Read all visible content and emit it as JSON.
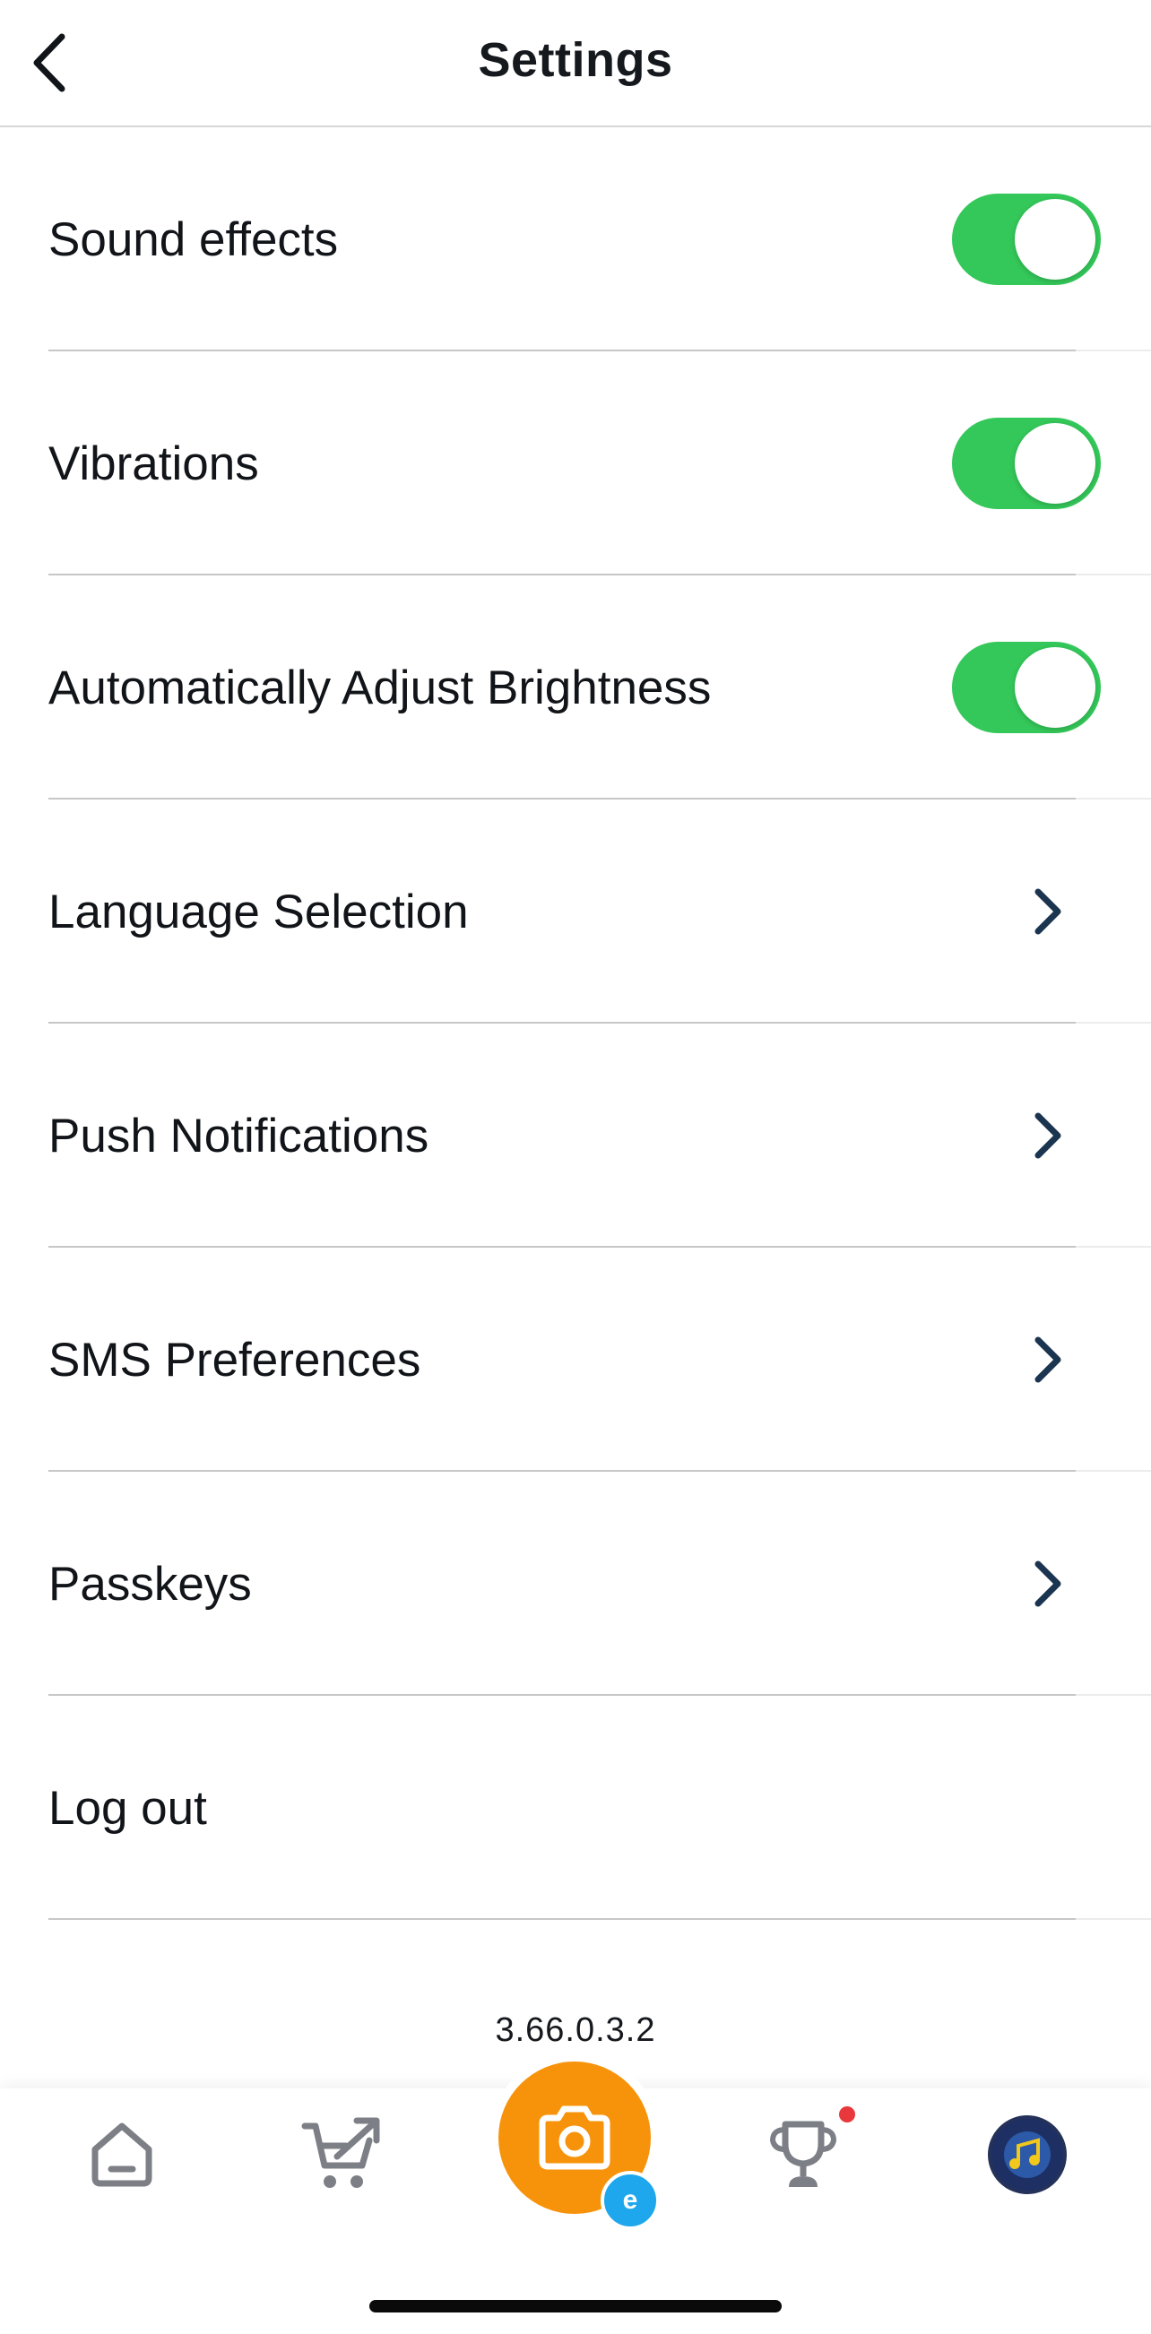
{
  "header": {
    "title": "Settings",
    "back_icon": "chevron-left-icon"
  },
  "settings": {
    "items": [
      {
        "label": "Sound effects",
        "control": "toggle",
        "on": true
      },
      {
        "label": "Vibrations",
        "control": "toggle",
        "on": true
      },
      {
        "label": "Automatically Adjust Brightness",
        "control": "toggle",
        "on": true
      },
      {
        "label": "Language Selection",
        "control": "chevron"
      },
      {
        "label": "Push Notifications",
        "control": "chevron"
      },
      {
        "label": "SMS Preferences",
        "control": "chevron"
      },
      {
        "label": "Passkeys",
        "control": "chevron"
      },
      {
        "label": "Log out",
        "control": "none"
      }
    ]
  },
  "version": "3.66.0.3.2",
  "bottom_nav": {
    "items": [
      {
        "name": "home",
        "icon": "home-icon"
      },
      {
        "name": "shop",
        "icon": "cart-arrow-icon"
      },
      {
        "name": "scan",
        "icon": "camera-icon",
        "badge_text": "e"
      },
      {
        "name": "rewards",
        "icon": "trophy-icon",
        "has_notification_dot": true
      },
      {
        "name": "profile",
        "icon": "avatar-icon"
      }
    ]
  },
  "colors": {
    "toggle_on": "#34c759",
    "chevron": "#1b3550",
    "camera_button": "#f7930a",
    "camera_badge": "#1ea7ec",
    "notification_dot": "#e8383b",
    "nav_icon": "#7d7f86",
    "avatar_bg": "#1d2f63",
    "avatar_accent": "#f2c81c"
  }
}
